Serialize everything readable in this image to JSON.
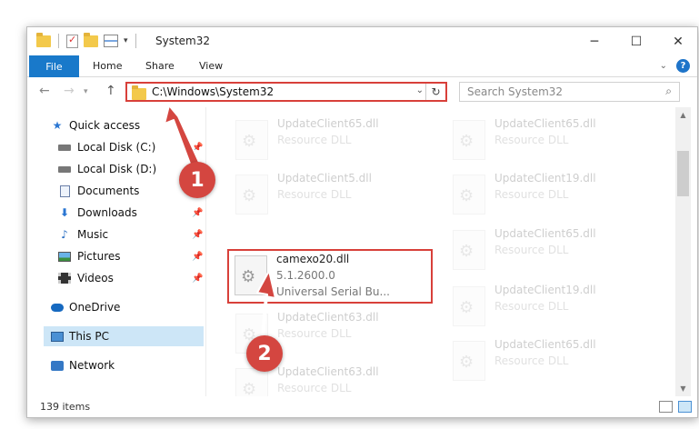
{
  "window": {
    "title": "System32"
  },
  "ribbon": {
    "tabs": [
      "File",
      "Home",
      "Share",
      "View"
    ]
  },
  "address": {
    "path": "C:\\Windows\\System32",
    "search_placeholder": "Search System32"
  },
  "sidebar": {
    "items": [
      {
        "label": "Quick access",
        "icon": "star-icon"
      },
      {
        "label": "Local Disk (C:)",
        "icon": "disk-icon",
        "pinned": true
      },
      {
        "label": "Local Disk (D:)",
        "icon": "disk-icon"
      },
      {
        "label": "Documents",
        "icon": "documents-icon",
        "pinned": true
      },
      {
        "label": "Downloads",
        "icon": "download-icon",
        "pinned": true
      },
      {
        "label": "Music",
        "icon": "music-icon",
        "pinned": true
      },
      {
        "label": "Pictures",
        "icon": "pictures-icon",
        "pinned": true
      },
      {
        "label": "Videos",
        "icon": "videos-icon",
        "pinned": true
      },
      {
        "label": "OneDrive",
        "icon": "onedrive-icon"
      },
      {
        "label": "This PC",
        "icon": "pc-icon",
        "selected": true
      },
      {
        "label": "Network",
        "icon": "network-icon"
      }
    ]
  },
  "files": {
    "left": [
      {
        "name": "UpdateClient65.dll",
        "desc": "Resource DLL"
      },
      {
        "name": "UpdateClient5.dll",
        "desc": "Resource DLL"
      },
      {
        "name": "camexo20.dll",
        "desc": "5.1.2600.0",
        "desc2": "Universal Serial Bu...",
        "highlighted": true
      },
      {
        "name": "UpdateClient63.dll",
        "desc": "Resource DLL"
      },
      {
        "name": "UpdateClient63.dll",
        "desc": "Resource DLL"
      }
    ],
    "right": [
      {
        "name": "UpdateClient65.dll",
        "desc": "Resource DLL"
      },
      {
        "name": "UpdateClient19.dll",
        "desc": "Resource DLL"
      },
      {
        "name": "UpdateClient65.dll",
        "desc": "Resource DLL"
      },
      {
        "name": "UpdateClient19.dll",
        "desc": "Resource DLL"
      },
      {
        "name": "UpdateClient65.dll",
        "desc": "Resource DLL"
      }
    ]
  },
  "status": {
    "items_count": "139 items"
  },
  "annotations": {
    "step1": "1",
    "step2": "2",
    "color": "#d44640"
  }
}
